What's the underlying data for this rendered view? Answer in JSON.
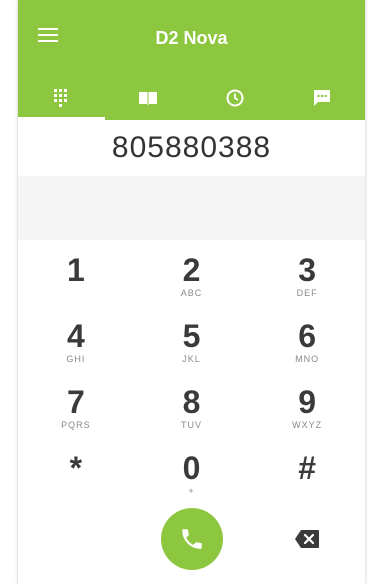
{
  "app": {
    "title": "D2 Nova",
    "menu_icon": "hamburger-menu-icon"
  },
  "tabs": [
    {
      "icon": "dialpad-icon",
      "active": true
    },
    {
      "icon": "contacts-book-icon",
      "active": false
    },
    {
      "icon": "history-clock-icon",
      "active": false
    },
    {
      "icon": "chat-message-icon",
      "active": false
    }
  ],
  "dialer": {
    "number": "805880388"
  },
  "keys": [
    [
      {
        "digit": "1",
        "letters": ""
      },
      {
        "digit": "2",
        "letters": "ABC"
      },
      {
        "digit": "3",
        "letters": "DEF"
      }
    ],
    [
      {
        "digit": "4",
        "letters": "GHI"
      },
      {
        "digit": "5",
        "letters": "JKL"
      },
      {
        "digit": "6",
        "letters": "MNO"
      }
    ],
    [
      {
        "digit": "7",
        "letters": "PQRS"
      },
      {
        "digit": "8",
        "letters": "TUV"
      },
      {
        "digit": "9",
        "letters": "WXYZ"
      }
    ],
    [
      {
        "digit": "*",
        "letters": ""
      },
      {
        "digit": "0",
        "letters": "+"
      },
      {
        "digit": "#",
        "letters": ""
      }
    ]
  ],
  "colors": {
    "accent": "#8dc63f",
    "text": "#3a3a3a",
    "subtext": "#888888"
  }
}
